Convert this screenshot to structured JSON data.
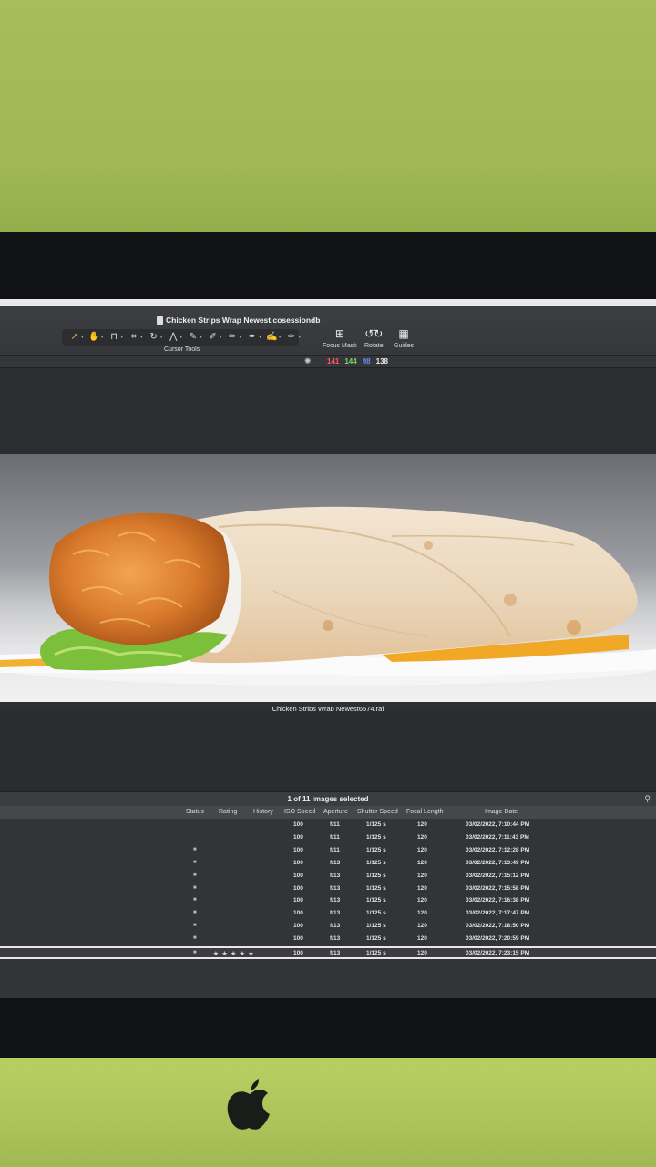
{
  "window": {
    "title": "Chicken Strips Wrap Newest.cosessiondb"
  },
  "toolbar": {
    "cursor_tools_label": "Cursor Tools",
    "tools": [
      {
        "icon": "select-arrow-icon",
        "glyph": "➚",
        "active": true
      },
      {
        "icon": "pan-hand-icon",
        "glyph": "✋",
        "active": false
      },
      {
        "icon": "loupe-icon",
        "glyph": "⊓",
        "active": false
      },
      {
        "icon": "crop-icon",
        "glyph": "⌗",
        "active": false
      },
      {
        "icon": "rotate-tool-icon",
        "glyph": "↻",
        "active": false
      },
      {
        "icon": "keystone-icon",
        "glyph": "⋀",
        "active": false
      },
      {
        "icon": "brush-icon",
        "glyph": "✎",
        "active": false
      },
      {
        "icon": "eraser-icon",
        "glyph": "✐",
        "active": false
      },
      {
        "icon": "pen-icon",
        "glyph": "✏",
        "active": false
      },
      {
        "icon": "mask-brush-icon",
        "glyph": "✒",
        "active": false
      },
      {
        "icon": "picker-icon",
        "glyph": "✍",
        "active": false
      },
      {
        "icon": "annotate-icon",
        "glyph": "✑",
        "active": false
      }
    ],
    "focus_mask_label": "Focus Mask",
    "rotate_label": "Rotate",
    "guides_label": "Guides"
  },
  "status": {
    "r": "141",
    "g": "144",
    "b": "98",
    "l": "138",
    "r_color": "#ff5a5a",
    "g_color": "#7ed36a",
    "b_color": "#6a8cff",
    "l_color": "#eeeeee"
  },
  "viewer": {
    "filename": "Chicken Strips Wrap Newest6574.raf"
  },
  "browser": {
    "selection_text": "1 of 11 images selected",
    "columns": {
      "status": "Status",
      "rating": "Rating",
      "history": "History",
      "iso": "ISO Speed",
      "aperture": "Aperture",
      "shutter": "Shutter Speed",
      "focal": "Focal Length",
      "date": "Image Date"
    },
    "rows": [
      {
        "status": "",
        "rating": "",
        "iso": "100",
        "aperture": "f/11",
        "shutter": "1/125 s",
        "focal": "120",
        "date": "03/02/2022, 7:10:44 PM"
      },
      {
        "status": "",
        "rating": "",
        "iso": "100",
        "aperture": "f/11",
        "shutter": "1/125 s",
        "focal": "120",
        "date": "03/02/2022, 7:11:43 PM"
      },
      {
        "status": "■",
        "rating": "",
        "iso": "100",
        "aperture": "f/11",
        "shutter": "1/125 s",
        "focal": "120",
        "date": "03/02/2022, 7:12:28 PM"
      },
      {
        "status": "■",
        "rating": "",
        "iso": "100",
        "aperture": "f/13",
        "shutter": "1/125 s",
        "focal": "120",
        "date": "03/02/2022, 7:13:49 PM"
      },
      {
        "status": "■",
        "rating": "",
        "iso": "100",
        "aperture": "f/13",
        "shutter": "1/125 s",
        "focal": "120",
        "date": "03/02/2022, 7:15:12 PM"
      },
      {
        "status": "■",
        "rating": "",
        "iso": "100",
        "aperture": "f/13",
        "shutter": "1/125 s",
        "focal": "120",
        "date": "03/02/2022, 7:15:58 PM"
      },
      {
        "status": "■",
        "rating": "",
        "iso": "100",
        "aperture": "f/13",
        "shutter": "1/125 s",
        "focal": "120",
        "date": "03/02/2022, 7:16:38 PM"
      },
      {
        "status": "■",
        "rating": "",
        "iso": "100",
        "aperture": "f/13",
        "shutter": "1/125 s",
        "focal": "120",
        "date": "03/02/2022, 7:17:47 PM"
      },
      {
        "status": "■",
        "rating": "",
        "iso": "100",
        "aperture": "f/13",
        "shutter": "1/125 s",
        "focal": "120",
        "date": "03/02/2022, 7:18:50 PM"
      },
      {
        "status": "■",
        "rating": "",
        "iso": "100",
        "aperture": "f/13",
        "shutter": "1/125 s",
        "focal": "120",
        "date": "03/02/2022, 7:20:59 PM"
      },
      {
        "status": "■",
        "rating": "★ ★ ★ ★ ★",
        "iso": "100",
        "aperture": "f/13",
        "shutter": "1/125 s",
        "focal": "120",
        "date": "03/02/2022, 7:23:15 PM"
      }
    ],
    "selected_row": 10
  }
}
